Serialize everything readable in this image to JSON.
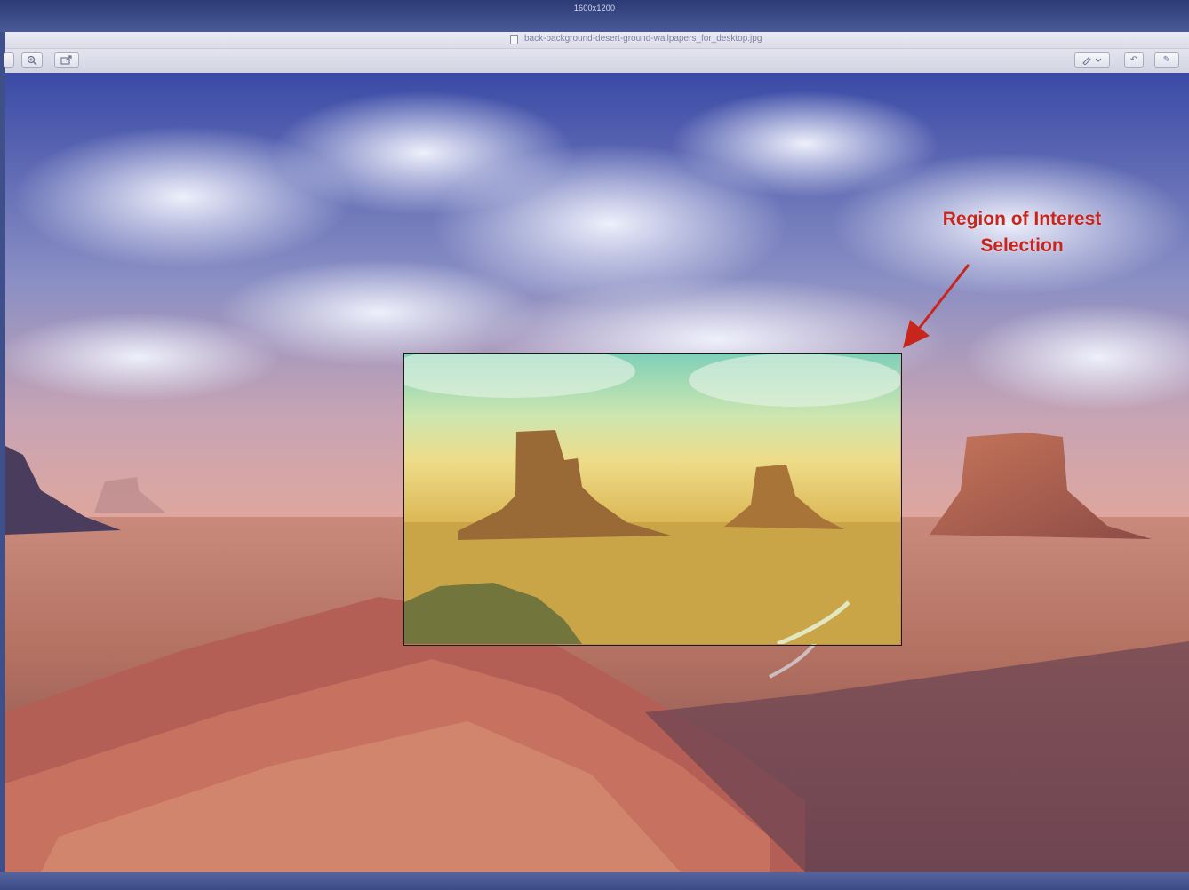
{
  "desktop": {
    "dimensions_label": "1600x1200"
  },
  "window": {
    "title": "back-background-desert-ground-wallpapers_for_desktop.jpg",
    "toolbar": {
      "zoom_icon": "zoom-in-icon",
      "share_icon": "share-icon",
      "markup_icon": "pen-icon",
      "rotate_icon": "rotate-icon",
      "edit_icon": "edit-icon"
    }
  },
  "annotation": {
    "label_line1": "Region of Interest",
    "label_line2": "Selection",
    "color": "#c8251c"
  }
}
